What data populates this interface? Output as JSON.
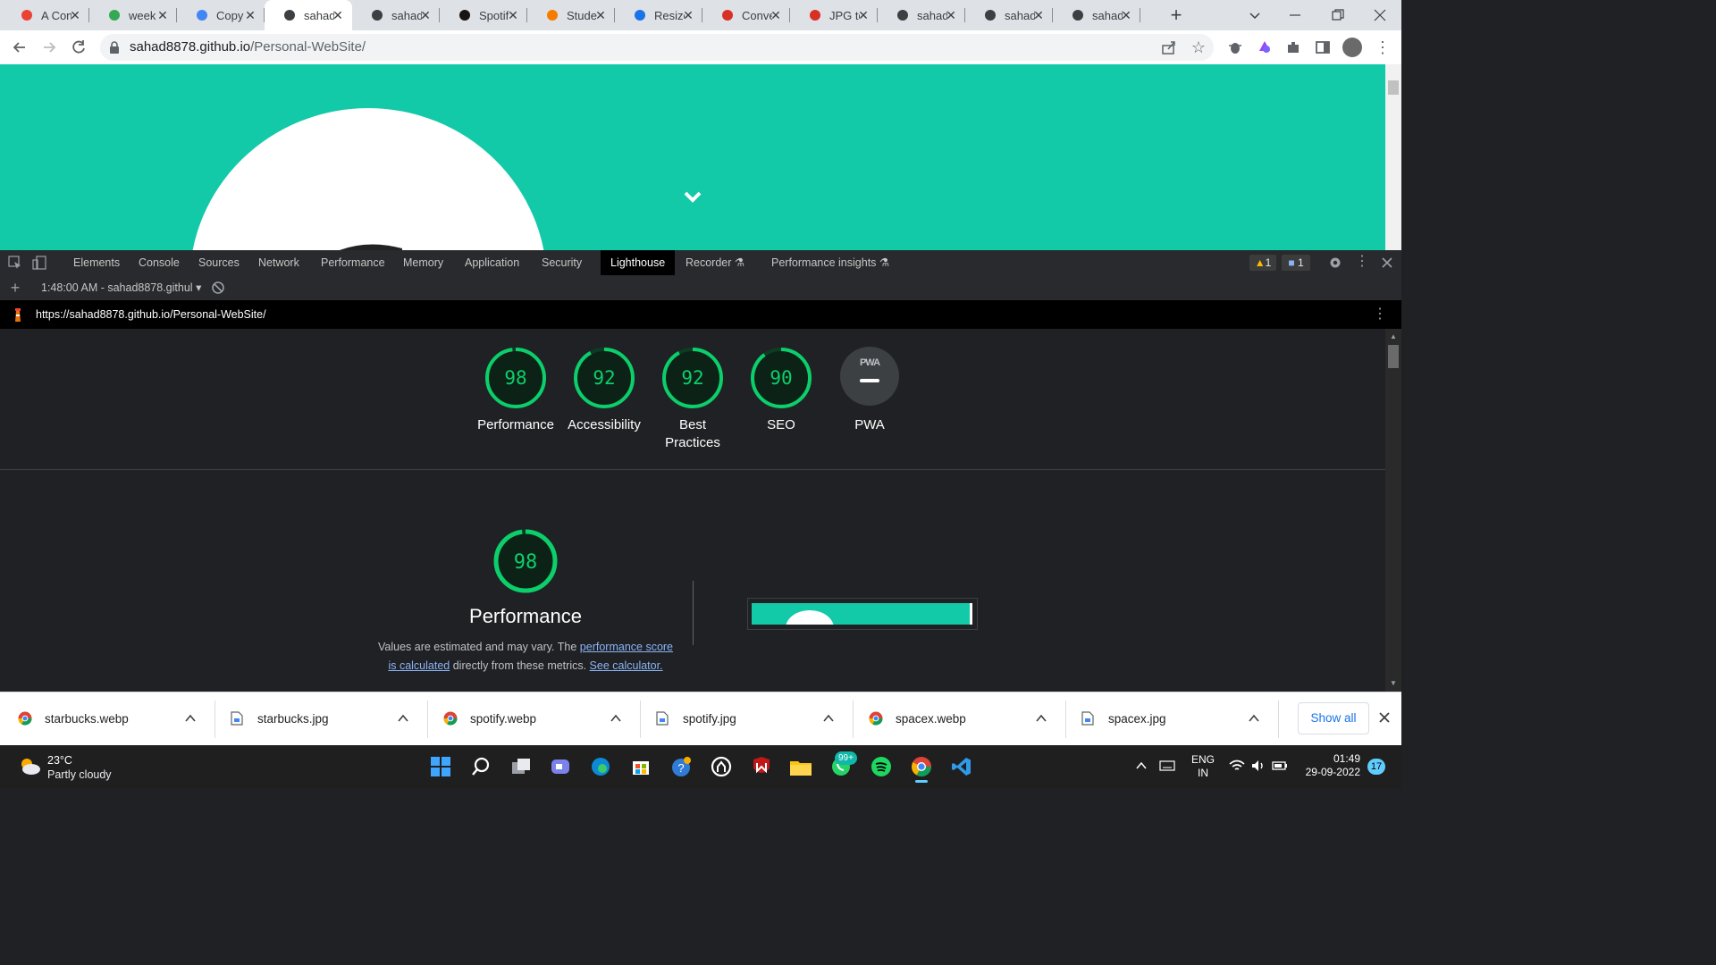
{
  "tabs": [
    {
      "title": "A Con",
      "icon": "asterisk-icon"
    },
    {
      "title": "week",
      "icon": "drive-icon"
    },
    {
      "title": "Copy",
      "icon": "docs-icon"
    },
    {
      "title": "sahad",
      "icon": "avatar-icon",
      "active": true
    },
    {
      "title": "sahad",
      "icon": "avatar-icon"
    },
    {
      "title": "Spotif",
      "icon": "spotify-icon"
    },
    {
      "title": "Stude",
      "icon": "fox-icon"
    },
    {
      "title": "Resize",
      "icon": "resize-icon"
    },
    {
      "title": "Conve",
      "icon": "convert-icon"
    },
    {
      "title": "JPG to",
      "icon": "cloud-icon"
    },
    {
      "title": "sahad",
      "icon": "avatar-icon"
    },
    {
      "title": "sahad",
      "icon": "avatar-icon"
    },
    {
      "title": "sahad",
      "icon": "avatar-icon"
    }
  ],
  "address": {
    "domain": "sahad8878.github.io",
    "path": "/Personal-WebSite/"
  },
  "devtools": {
    "tabs": [
      "Elements",
      "Console",
      "Sources",
      "Network",
      "Performance",
      "Memory",
      "Application",
      "Security",
      "Lighthouse",
      "Recorder",
      "Performance insights"
    ],
    "active_tab": "Lighthouse",
    "warnings": "1",
    "messages": "1",
    "report_select": "1:48:00 AM - sahad8878.githul",
    "report_url": "https://sahad8878.github.io/Personal-WebSite/"
  },
  "lighthouse": {
    "categories": [
      {
        "score": "98",
        "label": "Performance"
      },
      {
        "score": "92",
        "label": "Accessibility"
      },
      {
        "score": "92",
        "label": "Best Practices"
      },
      {
        "score": "90",
        "label": "SEO"
      }
    ],
    "pwa": {
      "badge": "PWA",
      "label": "PWA"
    },
    "performance_section": {
      "score": "98",
      "title": "Performance",
      "desc_prefix": "Values are estimated and may vary. The ",
      "link1": "performance score is calculated",
      "desc_mid": " directly from these metrics. ",
      "link2": "See calculator."
    },
    "score_color": "#0cce6b"
  },
  "downloads": {
    "items": [
      {
        "name": "starbucks.webp",
        "icon": "chrome-icon"
      },
      {
        "name": "starbucks.jpg",
        "icon": "file-icon"
      },
      {
        "name": "spotify.webp",
        "icon": "chrome-icon"
      },
      {
        "name": "spotify.jpg",
        "icon": "file-icon"
      },
      {
        "name": "spacex.webp",
        "icon": "chrome-icon"
      },
      {
        "name": "spacex.jpg",
        "icon": "file-icon"
      }
    ],
    "show_all": "Show all"
  },
  "taskbar": {
    "temperature": "23°C",
    "weather": "Partly cloudy",
    "whatsapp_badge": "99+",
    "lang1": "ENG",
    "lang2": "IN",
    "time": "01:49",
    "date": "29-09-2022",
    "notifications": "17"
  },
  "colors": {
    "page_bg": "#12c9a8",
    "accent": "#1a73e8"
  }
}
